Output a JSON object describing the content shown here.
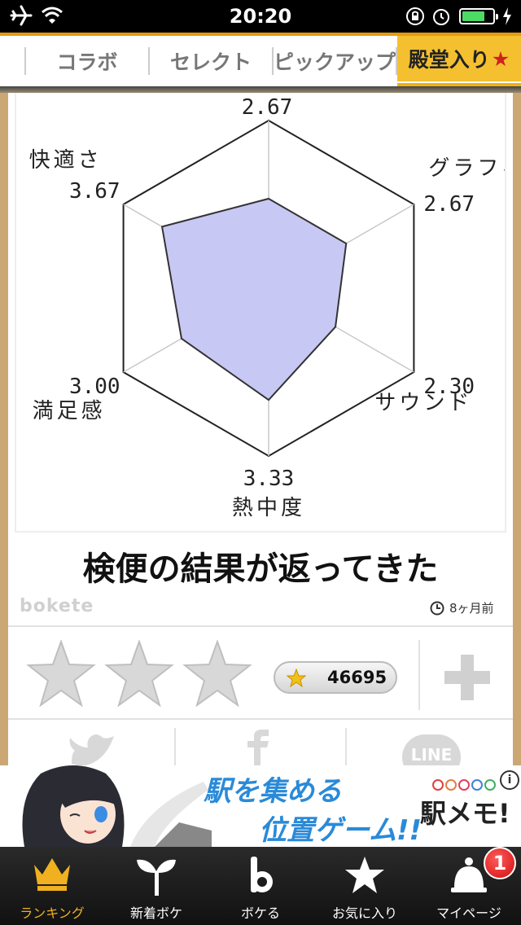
{
  "status_bar": {
    "time": "20:20",
    "battery_level": 0.75
  },
  "tabs": [
    {
      "label": "コラボ"
    },
    {
      "label": "セレクト"
    },
    {
      "label": "ピックアップ"
    },
    {
      "label": "殿堂入り",
      "star": "★"
    }
  ],
  "chart": {
    "axes": [
      {
        "name": "",
        "value": "2.67"
      },
      {
        "name": "グラフィック",
        "value": "2.67"
      },
      {
        "name": "サウンド",
        "value": "2.30"
      },
      {
        "name": "熱中度",
        "value": "3.33"
      },
      {
        "name": "満足感",
        "value": "3.00"
      },
      {
        "name": "快適さ",
        "value": "3.67"
      }
    ],
    "fill_color": "#c8c8f4"
  },
  "chart_data": {
    "type": "radar",
    "categories": [
      "",
      "グラフィック",
      "サウンド",
      "熱中度",
      "満足感",
      "快適さ"
    ],
    "values": [
      2.67,
      2.67,
      2.3,
      3.33,
      3.0,
      3.67
    ],
    "ylim": [
      0,
      5
    ]
  },
  "post": {
    "caption": "検便の結果が返ってきた",
    "logo": "bokete",
    "time_ago": "8ヶ月前",
    "score": "46695"
  },
  "share": {
    "line_label": "LINE"
  },
  "ad": {
    "headline1": "駅を集める",
    "headline2": "位置ゲーム!!",
    "brand": "駅メモ!",
    "info": "i"
  },
  "bottom_nav": [
    {
      "label": "ランキング",
      "icon": "crown-icon"
    },
    {
      "label": "新着ボケ",
      "icon": "sprout-icon"
    },
    {
      "label": "ボケる",
      "icon": "bokete-b-icon"
    },
    {
      "label": "お気に入り",
      "icon": "star-icon"
    },
    {
      "label": "マイページ",
      "icon": "bell-icon"
    }
  ],
  "badge": "1",
  "colors": {
    "accent": "#f0b010",
    "chart_fill": "#c8c8f4",
    "link_blue": "#2a8ad8",
    "badge_red": "#d01010"
  }
}
